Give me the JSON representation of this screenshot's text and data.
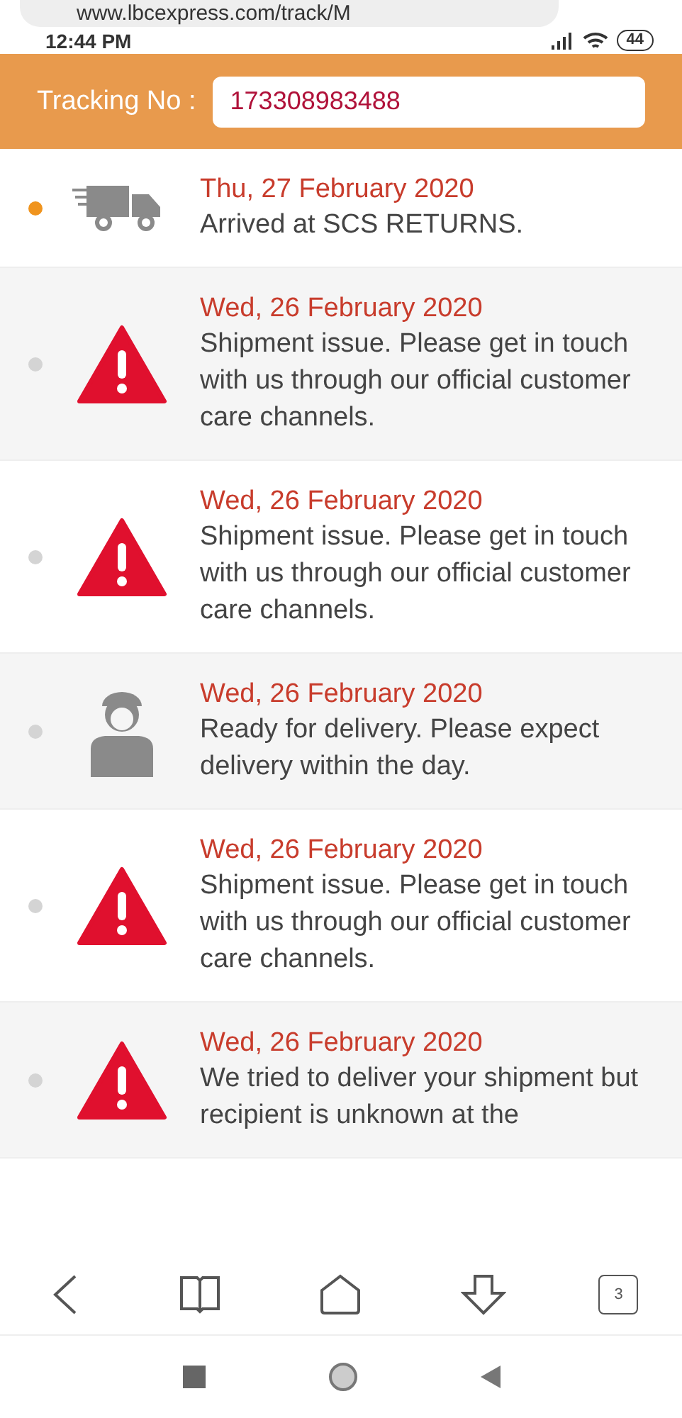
{
  "browser": {
    "url": "www.lbcexpress.com/track/M"
  },
  "status_bar": {
    "time": "12:44 PM",
    "battery": "44"
  },
  "tracking": {
    "label": "Tracking No :",
    "value": "173308983488"
  },
  "events": [
    {
      "kind": "truck",
      "current": true,
      "date": "Thu, 27 February 2020",
      "text": "Arrived at SCS RETURNS."
    },
    {
      "kind": "warning",
      "current": false,
      "date": "Wed, 26 February 2020",
      "text": "Shipment issue. Please get in touch with us through our official customer care channels."
    },
    {
      "kind": "warning",
      "current": false,
      "date": "Wed, 26 February 2020",
      "text": "Shipment issue. Please get in touch with us through our official customer care channels."
    },
    {
      "kind": "courier",
      "current": false,
      "date": "Wed, 26 February 2020",
      "text": "Ready for delivery. Please expect delivery within the day."
    },
    {
      "kind": "warning",
      "current": false,
      "date": "Wed, 26 February 2020",
      "text": "Shipment issue. Please get in touch with us through our official customer care channels."
    },
    {
      "kind": "warning",
      "current": false,
      "date": "Wed, 26 February 2020",
      "text": "We tried to deliver your shipment but recipient is unknown at the"
    }
  ],
  "bottom_bar": {
    "tab_count": "3"
  }
}
